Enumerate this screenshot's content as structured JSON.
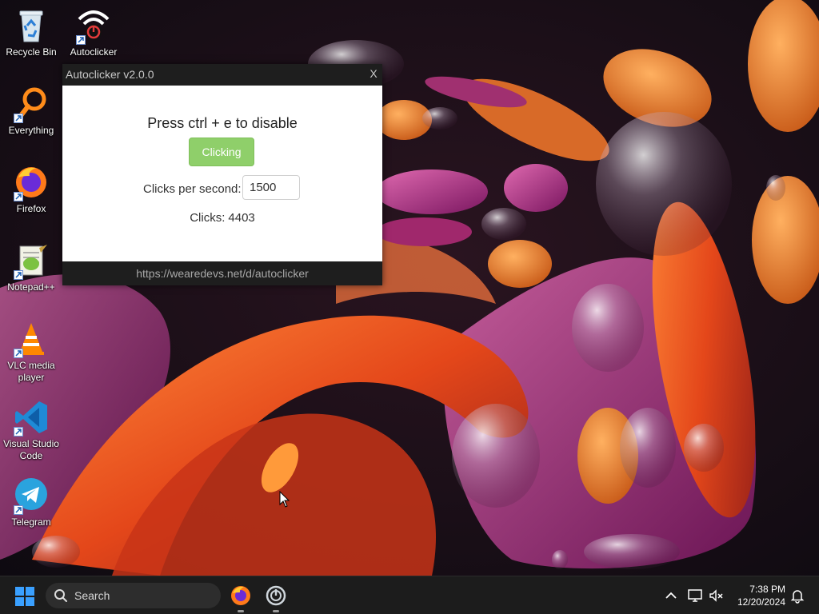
{
  "desktop": {
    "icons": [
      {
        "label": "Recycle Bin",
        "icon": "recycle-bin-icon",
        "shortcut": false
      },
      {
        "label": "Autoclicker",
        "icon": "autoclicker-icon",
        "shortcut": true
      },
      {
        "label": "Everything",
        "icon": "everything-search-icon",
        "shortcut": true
      },
      {
        "label": "Firefox",
        "icon": "firefox-icon",
        "shortcut": true
      },
      {
        "label": "Notepad++",
        "icon": "notepad-plus-plus-icon",
        "shortcut": true
      },
      {
        "label": "VLC media player",
        "icon": "vlc-icon",
        "shortcut": true
      },
      {
        "label": "Visual Studio Code",
        "icon": "vscode-icon",
        "shortcut": true
      },
      {
        "label": "Telegram",
        "icon": "telegram-icon",
        "shortcut": true
      }
    ]
  },
  "window": {
    "title": "Autoclicker v2.0.0",
    "close": "X",
    "instruction": "Press ctrl + e to disable",
    "toggle_label": "Clicking",
    "cps_label": "Clicks per second:",
    "cps_value": "1500",
    "clicks_label": "Clicks:",
    "clicks_value": "4403",
    "footer_url": "https://wearedevs.net/d/autoclicker"
  },
  "taskbar": {
    "search_placeholder": "Search",
    "apps": [
      {
        "icon": "firefox-icon",
        "running": true
      },
      {
        "icon": "autoclicker-icon",
        "running": true
      }
    ],
    "tray": [
      "chevron-up-icon",
      "display-icon",
      "volume-muted-icon",
      "notification-bell-icon"
    ],
    "time": "7:38 PM",
    "date": "12/20/2024"
  },
  "colors": {
    "toggle_active": "#8fcf6a",
    "window_chrome": "#1e1e1e",
    "taskbar": "#1c1c1c"
  }
}
